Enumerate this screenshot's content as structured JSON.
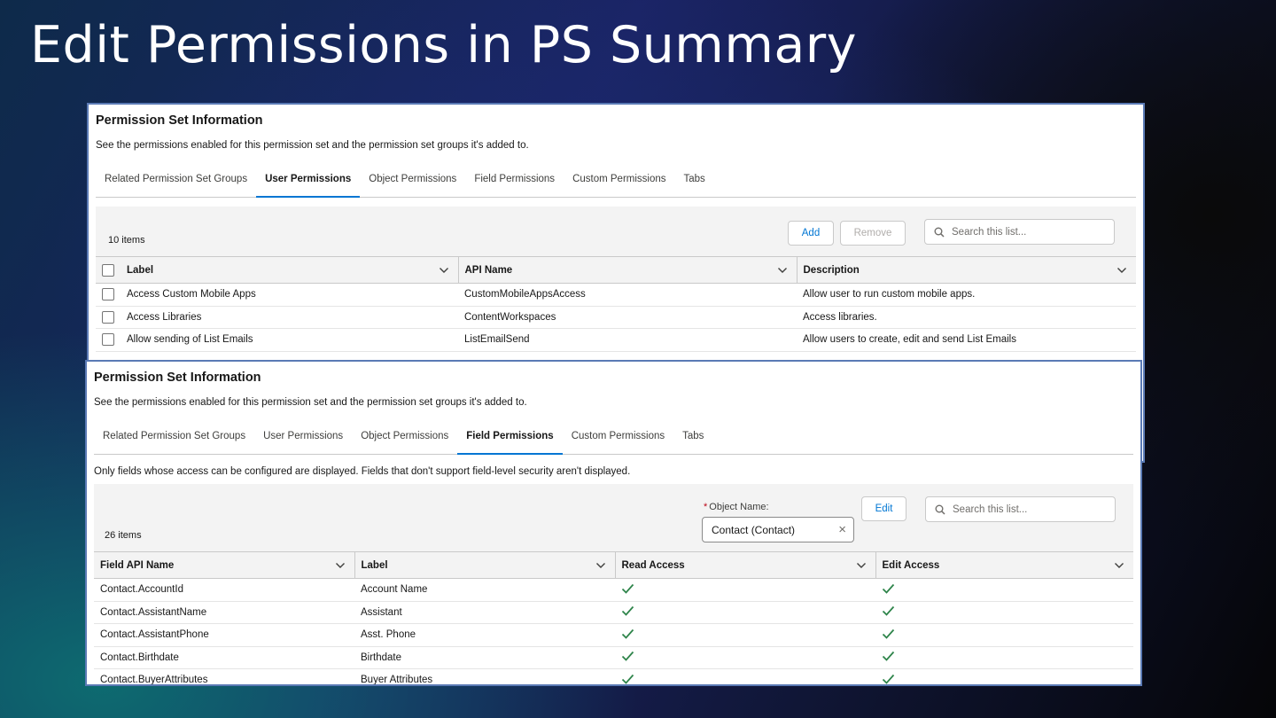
{
  "slide": {
    "title": "Edit Permissions in PS Summary"
  },
  "panel1": {
    "title": "Permission Set Information",
    "subtitle": "See the permissions enabled for this permission set and the permission set groups it's added to.",
    "tabs": [
      "Related Permission Set Groups",
      "User Permissions",
      "Object Permissions",
      "Field Permissions",
      "Custom Permissions",
      "Tabs"
    ],
    "active_tab": "User Permissions",
    "count": "10 items",
    "add_label": "Add",
    "remove_label": "Remove",
    "search_placeholder": "Search this list...",
    "columns": [
      "Label",
      "API Name",
      "Description"
    ],
    "rows": [
      {
        "label": "Access Custom Mobile Apps",
        "api": "CustomMobileAppsAccess",
        "desc": "Allow user to run custom mobile apps."
      },
      {
        "label": "Access Libraries",
        "api": "ContentWorkspaces",
        "desc": "Access libraries."
      },
      {
        "label": "Allow sending of List Emails",
        "api": "ListEmailSend",
        "desc": "Allow users to create, edit and send List Emails"
      }
    ]
  },
  "panel2": {
    "title": "Permission Set Information",
    "subtitle": "See the permissions enabled for this permission set and the permission set groups it's added to.",
    "tabs": [
      "Related Permission Set Groups",
      "User Permissions",
      "Object Permissions",
      "Field Permissions",
      "Custom Permissions",
      "Tabs"
    ],
    "active_tab": "Field Permissions",
    "note": "Only fields whose access can be configured are displayed. Fields that don't support field-level security aren't displayed.",
    "count": "26 items",
    "object_label": "Object Name:",
    "object_value": "Contact (Contact)",
    "edit_label": "Edit",
    "search_placeholder": "Search this list...",
    "columns": [
      "Field API Name",
      "Label",
      "Read Access",
      "Edit Access"
    ],
    "rows": [
      {
        "api": "Contact.AccountId",
        "label": "Account Name",
        "read": true,
        "edit": true
      },
      {
        "api": "Contact.AssistantName",
        "label": "Assistant",
        "read": true,
        "edit": true
      },
      {
        "api": "Contact.AssistantPhone",
        "label": "Asst. Phone",
        "read": true,
        "edit": true
      },
      {
        "api": "Contact.Birthdate",
        "label": "Birthdate",
        "read": true,
        "edit": true
      },
      {
        "api": "Contact.BuyerAttributes",
        "label": "Buyer Attributes",
        "read": true,
        "edit": true
      }
    ]
  },
  "colors": {
    "brand": "#0176d3",
    "check": "#2e844a",
    "required": "#ba0517"
  },
  "icons": [
    "search-icon",
    "chevron-down-icon",
    "checkmark-icon",
    "clear-icon",
    "checkbox-icon"
  ]
}
